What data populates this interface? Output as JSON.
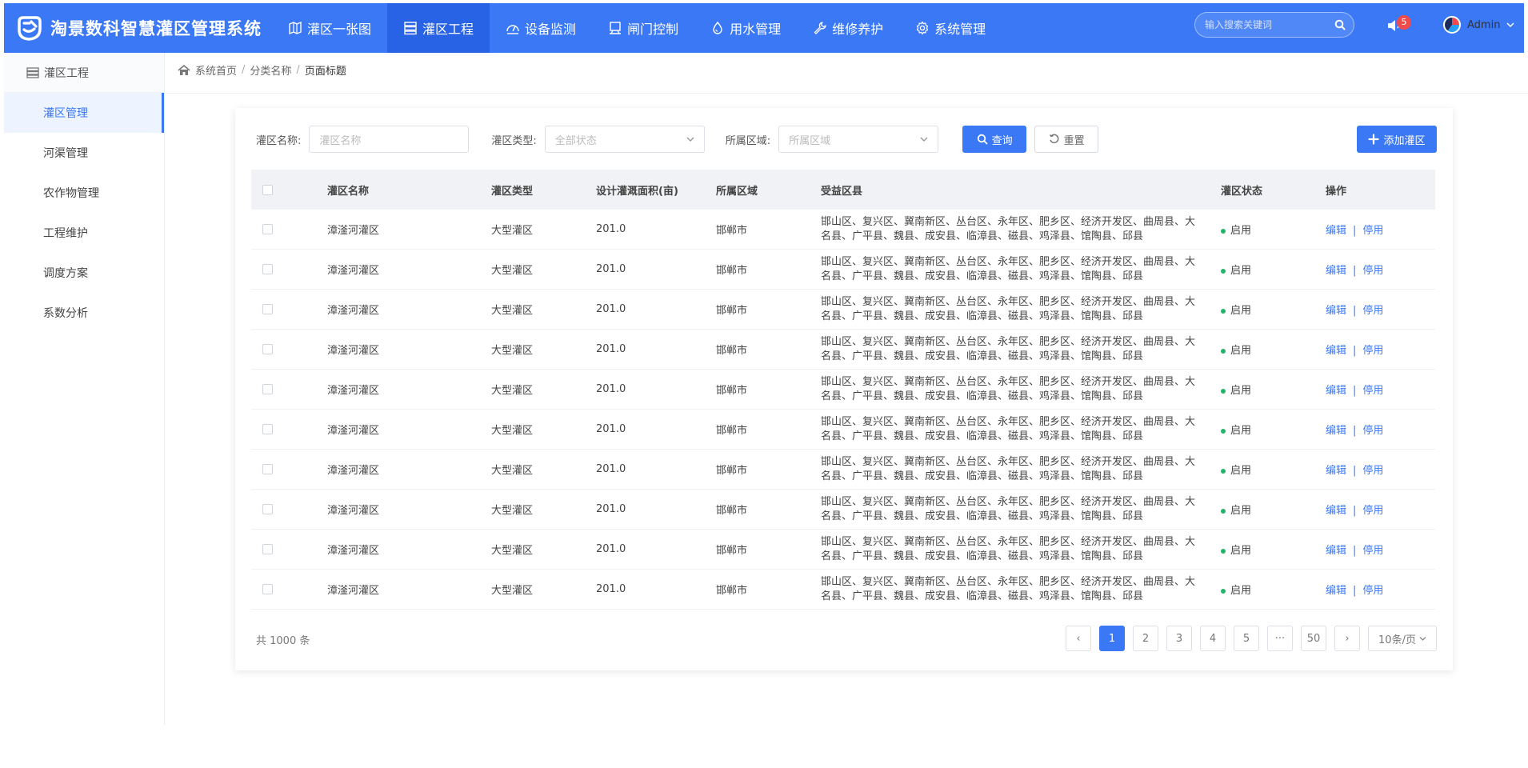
{
  "app": {
    "title": "淘景数科智慧灌区管理系统",
    "brand_color": "#3a78f6",
    "logo_icon": "logo-mark-icon"
  },
  "nav": [
    {
      "label": "灌区一张图",
      "icon": "map-icon",
      "active": false
    },
    {
      "label": "灌区工程",
      "icon": "server-icon",
      "active": true
    },
    {
      "label": "设备监测",
      "icon": "gauge-icon",
      "active": false
    },
    {
      "label": "闸门控制",
      "icon": "monitor-icon",
      "active": false
    },
    {
      "label": "用水管理",
      "icon": "water-drop-icon",
      "active": false
    },
    {
      "label": "维修养护",
      "icon": "wrench-icon",
      "active": false
    },
    {
      "label": "系统管理",
      "icon": "gear-icon",
      "active": false
    }
  ],
  "header": {
    "search_placeholder": "输入搜索关键词",
    "notification_count": "5",
    "user_name": "Admin"
  },
  "sidebar": {
    "title": "灌区工程",
    "items": [
      {
        "label": "灌区管理",
        "active": true
      },
      {
        "label": "河渠管理",
        "active": false
      },
      {
        "label": "农作物管理",
        "active": false
      },
      {
        "label": "工程维护",
        "active": false
      },
      {
        "label": "调度方案",
        "active": false
      },
      {
        "label": "系数分析",
        "active": false
      }
    ]
  },
  "breadcrumb": [
    "系统首页",
    "分类名称",
    "页面标题"
  ],
  "filters": {
    "name_label": "灌区名称:",
    "name_placeholder": "灌区名称",
    "type_label": "灌区类型:",
    "type_placeholder": "全部状态",
    "region_label": "所属区域:",
    "region_placeholder": "所属区域",
    "query_button": "查询",
    "reset_button": "重置",
    "add_button": "添加灌区"
  },
  "table": {
    "columns": [
      "灌区名称",
      "灌区类型",
      "设计灌溉面积(亩)",
      "所属区域",
      "受益区县",
      "灌区状态",
      "操作"
    ],
    "rows": [
      {
        "name": "漳滏河灌区",
        "type": "大型灌区",
        "area": "201.0",
        "region": "邯郸市",
        "counties": "邯山区、复兴区、冀南新区、丛台区、永年区、肥乡区、经济开发区、曲周县、大名县、广平县、魏县、成安县、临漳县、磁县、鸡泽县、馆陶县、邱县",
        "status": "启用",
        "edit": "编辑",
        "disable": "停用"
      },
      {
        "name": "漳滏河灌区",
        "type": "大型灌区",
        "area": "201.0",
        "region": "邯郸市",
        "counties": "邯山区、复兴区、冀南新区、丛台区、永年区、肥乡区、经济开发区、曲周县、大名县、广平县、魏县、成安县、临漳县、磁县、鸡泽县、馆陶县、邱县",
        "status": "启用",
        "edit": "编辑",
        "disable": "停用"
      },
      {
        "name": "漳滏河灌区",
        "type": "大型灌区",
        "area": "201.0",
        "region": "邯郸市",
        "counties": "邯山区、复兴区、冀南新区、丛台区、永年区、肥乡区、经济开发区、曲周县、大名县、广平县、魏县、成安县、临漳县、磁县、鸡泽县、馆陶县、邱县",
        "status": "启用",
        "edit": "编辑",
        "disable": "停用"
      },
      {
        "name": "漳滏河灌区",
        "type": "大型灌区",
        "area": "201.0",
        "region": "邯郸市",
        "counties": "邯山区、复兴区、冀南新区、丛台区、永年区、肥乡区、经济开发区、曲周县、大名县、广平县、魏县、成安县、临漳县、磁县、鸡泽县、馆陶县、邱县",
        "status": "启用",
        "edit": "编辑",
        "disable": "停用"
      },
      {
        "name": "漳滏河灌区",
        "type": "大型灌区",
        "area": "201.0",
        "region": "邯郸市",
        "counties": "邯山区、复兴区、冀南新区、丛台区、永年区、肥乡区、经济开发区、曲周县、大名县、广平县、魏县、成安县、临漳县、磁县、鸡泽县、馆陶县、邱县",
        "status": "启用",
        "edit": "编辑",
        "disable": "停用"
      },
      {
        "name": "漳滏河灌区",
        "type": "大型灌区",
        "area": "201.0",
        "region": "邯郸市",
        "counties": "邯山区、复兴区、冀南新区、丛台区、永年区、肥乡区、经济开发区、曲周县、大名县、广平县、魏县、成安县、临漳县、磁县、鸡泽县、馆陶县、邱县",
        "status": "启用",
        "edit": "编辑",
        "disable": "停用"
      },
      {
        "name": "漳滏河灌区",
        "type": "大型灌区",
        "area": "201.0",
        "region": "邯郸市",
        "counties": "邯山区、复兴区、冀南新区、丛台区、永年区、肥乡区、经济开发区、曲周县、大名县、广平县、魏县、成安县、临漳县、磁县、鸡泽县、馆陶县、邱县",
        "status": "启用",
        "edit": "编辑",
        "disable": "停用"
      },
      {
        "name": "漳滏河灌区",
        "type": "大型灌区",
        "area": "201.0",
        "region": "邯郸市",
        "counties": "邯山区、复兴区、冀南新区、丛台区、永年区、肥乡区、经济开发区、曲周县、大名县、广平县、魏县、成安县、临漳县、磁县、鸡泽县、馆陶县、邱县",
        "status": "启用",
        "edit": "编辑",
        "disable": "停用"
      },
      {
        "name": "漳滏河灌区",
        "type": "大型灌区",
        "area": "201.0",
        "region": "邯郸市",
        "counties": "邯山区、复兴区、冀南新区、丛台区、永年区、肥乡区、经济开发区、曲周县、大名县、广平县、魏县、成安县、临漳县、磁县、鸡泽县、馆陶县、邱县",
        "status": "启用",
        "edit": "编辑",
        "disable": "停用"
      },
      {
        "name": "漳滏河灌区",
        "type": "大型灌区",
        "area": "201.0",
        "region": "邯郸市",
        "counties": "邯山区、复兴区、冀南新区、丛台区、永年区、肥乡区、经济开发区、曲周县、大名县、广平县、魏县、成安县、临漳县、磁县、鸡泽县、馆陶县、邱县",
        "status": "启用",
        "edit": "编辑",
        "disable": "停用"
      }
    ]
  },
  "pagination": {
    "total_text": "共 1000 条",
    "prev": "‹",
    "pages": [
      "1",
      "2",
      "3",
      "4",
      "5",
      "···",
      "50"
    ],
    "current": "1",
    "next": "›",
    "page_size": "10条/页"
  },
  "colors": {
    "primary": "#3a78f6",
    "active_nav": "#2763e4",
    "status_ok": "#25b36a",
    "badge": "#f04b4b"
  }
}
